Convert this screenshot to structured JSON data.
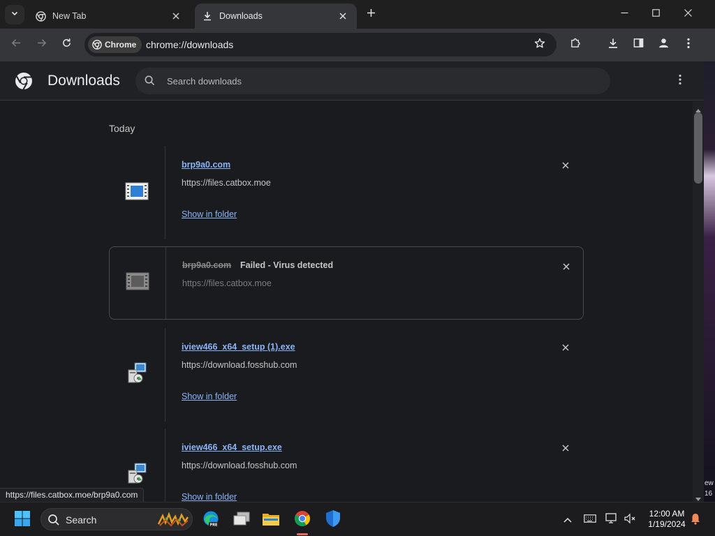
{
  "tabs": [
    {
      "title": "New Tab",
      "icon": "chrome-icon",
      "active": false
    },
    {
      "title": "Downloads",
      "icon": "download-icon",
      "active": true
    }
  ],
  "toolbar": {
    "chip_label": "Chrome",
    "url": "chrome://downloads"
  },
  "page": {
    "title": "Downloads",
    "search_placeholder": "Search downloads",
    "section_label": "Today"
  },
  "downloads": [
    {
      "filename": "brp9a0.com",
      "source": "https://files.catbox.moe",
      "action": "Show in folder",
      "status": "",
      "failed": false
    },
    {
      "filename": "brp9a0.com",
      "source": "https://files.catbox.moe",
      "action": "",
      "status": "Failed - Virus detected",
      "failed": true
    },
    {
      "filename": "iview466_x64_setup (1).exe",
      "source": "https://download.fosshub.com",
      "action": "Show in folder",
      "status": "",
      "failed": false
    },
    {
      "filename": "iview466_x64_setup.exe",
      "source": "https://download.fosshub.com",
      "action": "Show in folder",
      "status": "",
      "failed": false
    }
  ],
  "status_bubble": "https://files.catbox.moe/brp9a0.com",
  "desktop_fragments": [
    "ew",
    "16"
  ],
  "taskbar": {
    "search_label": "Search",
    "time": "12:00 AM",
    "date": "1/19/2024"
  },
  "colors": {
    "accent_link": "#8ab4f8",
    "background": "#1a1b1e",
    "toolbar": "#35363a"
  }
}
